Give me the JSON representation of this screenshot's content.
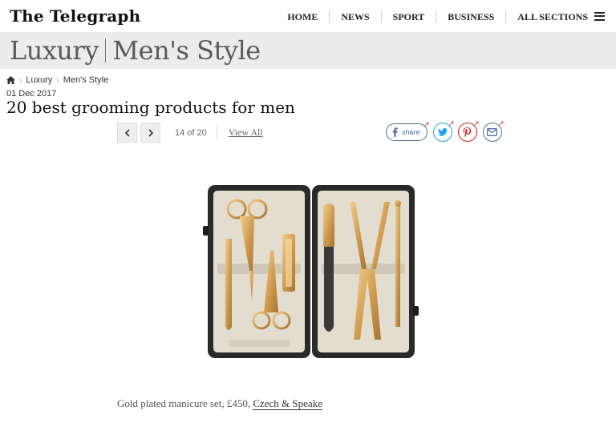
{
  "header": {
    "logo": "The Telegraph",
    "nav": [
      "HOME",
      "NEWS",
      "SPORT",
      "BUSINESS",
      "ALL SECTIONS"
    ]
  },
  "section": {
    "primary": "Luxury",
    "secondary": "Men's Style"
  },
  "breadcrumb": {
    "home_icon": "home-icon",
    "items": [
      "Luxury",
      "Men's Style"
    ]
  },
  "article": {
    "date": "01 Dec 2017",
    "headline": "20 best grooming products for men"
  },
  "gallery": {
    "counter": "14 of 20",
    "view_all": "View All",
    "prev_icon": "chevron-left-icon",
    "next_icon": "chevron-right-icon",
    "caption_text": "Gold plated manicure set, £450, ",
    "caption_link": "Czech & Speake"
  },
  "share": {
    "label": "share",
    "icons": [
      "facebook-icon",
      "twitter-icon",
      "pinterest-icon",
      "email-icon"
    ],
    "colors": {
      "facebook": "#4f6d9a",
      "twitter": "#1da1f2",
      "pinterest": "#cb2027",
      "email": "#4f6d9a"
    }
  },
  "colors": {
    "section_band": "#ececec",
    "section_text": "#5a5a5a",
    "gold": "#d6a45a"
  }
}
